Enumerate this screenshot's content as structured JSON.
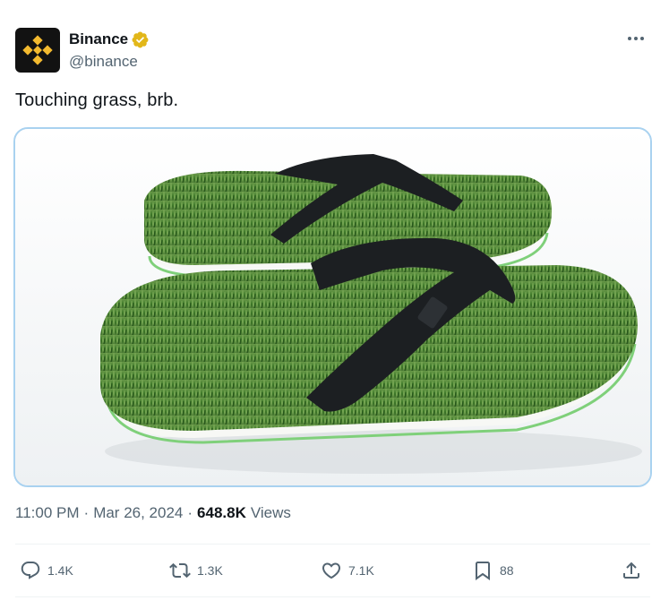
{
  "user": {
    "display_name": "Binance",
    "handle": "@binance",
    "verified": true,
    "brand_color": "#F3BA2F"
  },
  "tweet": {
    "text": "Touching grass, brb.",
    "time": "11:00 PM",
    "separator": "·",
    "date": "Mar 26, 2024",
    "views_count": "648.8K",
    "views_label": "Views"
  },
  "media": {
    "description_icon": "grass-flip-flops-photo"
  },
  "actions": {
    "reply_count": "1.4K",
    "repost_count": "1.3K",
    "like_count": "7.1K",
    "bookmark_count": "88"
  },
  "colors": {
    "text_primary": "#0f1419",
    "text_secondary": "#536471",
    "divider": "#eff3f4",
    "media_border": "#a9d2f0"
  }
}
